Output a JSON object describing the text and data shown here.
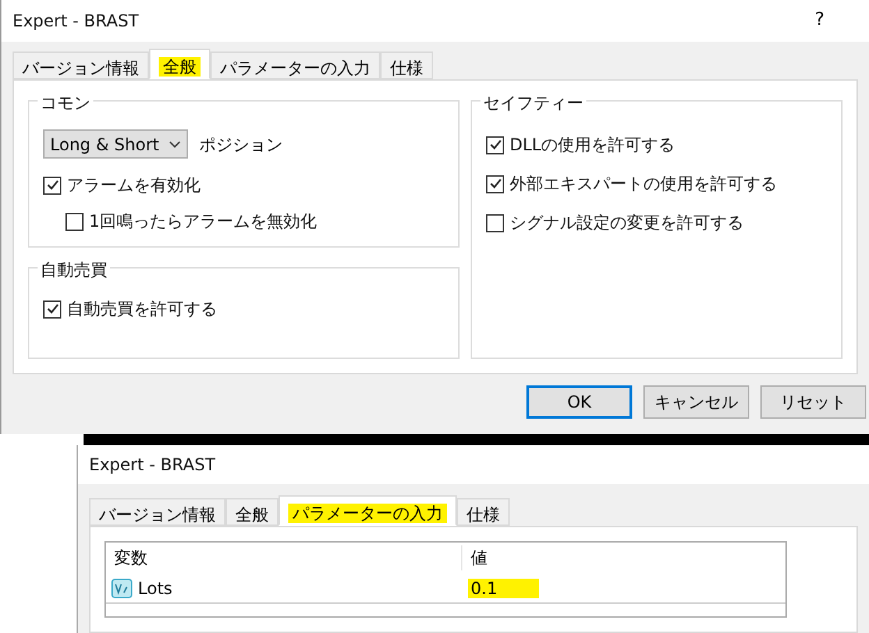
{
  "dialog_general": {
    "title": "Expert - BRAST",
    "help": "?",
    "tabs": [
      {
        "label": "バージョン情報",
        "selected": false,
        "highlighted": false
      },
      {
        "label": "全般",
        "selected": true,
        "highlighted": true
      },
      {
        "label": "パラメーターの入力",
        "selected": false,
        "highlighted": false
      },
      {
        "label": "仕様",
        "selected": false,
        "highlighted": false
      }
    ],
    "common": {
      "title": "コモン",
      "position_select": "Long & Short",
      "position_label": "ポジション",
      "checks": [
        {
          "label": "アラームを有効化",
          "checked": true,
          "indented": false
        },
        {
          "label": "1回鳴ったらアラームを無効化",
          "checked": false,
          "indented": true
        }
      ]
    },
    "auto_trading": {
      "title": "自動売買",
      "checks": [
        {
          "label": "自動売買を許可する",
          "checked": true
        }
      ]
    },
    "safety": {
      "title": "セイフティー",
      "checks": [
        {
          "label": "DLLの使用を許可する",
          "checked": true
        },
        {
          "label": "外部エキスパートの使用を許可する",
          "checked": true
        },
        {
          "label": "シグナル設定の変更を許可する",
          "checked": false
        }
      ]
    },
    "buttons": [
      {
        "label": "OK",
        "default": true
      },
      {
        "label": "キャンセル",
        "default": false
      },
      {
        "label": "リセット",
        "default": false
      }
    ]
  },
  "dialog_inputs": {
    "title": "Expert - BRAST",
    "tabs": [
      {
        "label": "バージョン情報",
        "selected": false,
        "highlighted": false
      },
      {
        "label": "全般",
        "selected": false,
        "highlighted": false
      },
      {
        "label": "パラメーターの入力",
        "selected": true,
        "highlighted": true
      },
      {
        "label": "仕様",
        "selected": false,
        "highlighted": false
      }
    ],
    "table": {
      "columns": [
        "変数",
        "値"
      ],
      "rows": [
        {
          "name": "Lots",
          "value": "0.1",
          "value_highlighted": true
        }
      ]
    }
  }
}
